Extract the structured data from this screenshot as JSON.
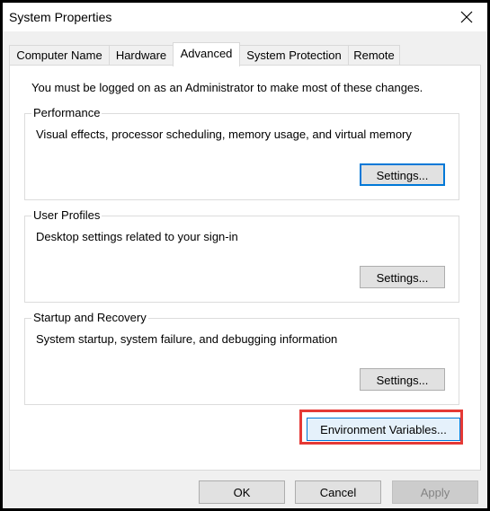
{
  "window": {
    "title": "System Properties",
    "close_icon": "close-icon"
  },
  "tabs": [
    {
      "label": "Computer Name",
      "active": false
    },
    {
      "label": "Hardware",
      "active": false
    },
    {
      "label": "Advanced",
      "active": true
    },
    {
      "label": "System Protection",
      "active": false
    },
    {
      "label": "Remote",
      "active": false
    }
  ],
  "advanced": {
    "admin_note": "You must be logged on as an Administrator to make most of these changes.",
    "groups": [
      {
        "label": "Performance",
        "description": "Visual effects, processor scheduling, memory usage, and virtual memory",
        "button": "Settings..."
      },
      {
        "label": "User Profiles",
        "description": "Desktop settings related to your sign-in",
        "button": "Settings..."
      },
      {
        "label": "Startup and Recovery",
        "description": "System startup, system failure, and debugging information",
        "button": "Settings..."
      }
    ],
    "env_button": "Environment Variables...",
    "highlight_color": "#e53935"
  },
  "footer": {
    "ok": "OK",
    "cancel": "Cancel",
    "apply": "Apply",
    "apply_enabled": false
  }
}
